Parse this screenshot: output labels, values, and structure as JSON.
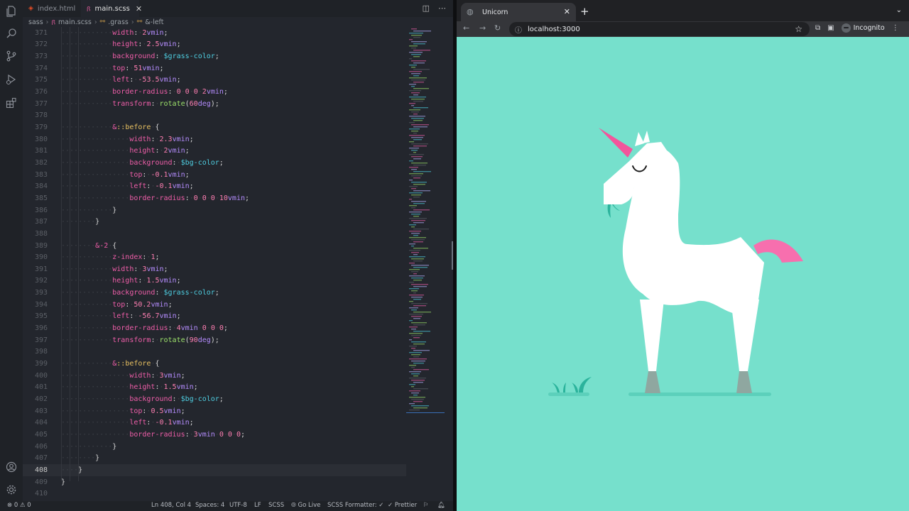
{
  "editor": {
    "tabs": [
      {
        "label": "index.html",
        "active": false,
        "icon": "html5-icon"
      },
      {
        "label": "main.scss",
        "active": true,
        "icon": "sass-icon"
      }
    ],
    "breadcrumb": [
      "sass",
      "main.scss",
      ".grass",
      "&-left"
    ],
    "current_line": 408,
    "lines": [
      {
        "n": "371",
        "indent": 3,
        "prop": "width",
        "value": "2vmin"
      },
      {
        "n": "372",
        "indent": 3,
        "prop": "height",
        "value": "2.5vmin"
      },
      {
        "n": "373",
        "indent": 3,
        "prop": "background",
        "value": "$grass-color"
      },
      {
        "n": "374",
        "indent": 3,
        "prop": "top",
        "value": "51vmin"
      },
      {
        "n": "375",
        "indent": 3,
        "prop": "left",
        "value": "-53.5vmin"
      },
      {
        "n": "376",
        "indent": 3,
        "prop": "border-radius",
        "value": "0 0 0 2vmin"
      },
      {
        "n": "377",
        "indent": 3,
        "prop": "transform",
        "value": "rotate(60deg)"
      },
      {
        "n": "378",
        "indent": 0,
        "raw": ""
      },
      {
        "n": "379",
        "indent": 3,
        "raw": "&::before {"
      },
      {
        "n": "380",
        "indent": 4,
        "prop": "width",
        "value": "2.3vmin"
      },
      {
        "n": "381",
        "indent": 4,
        "prop": "height",
        "value": "2vmin"
      },
      {
        "n": "382",
        "indent": 4,
        "prop": "background",
        "value": "$bg-color"
      },
      {
        "n": "383",
        "indent": 4,
        "prop": "top",
        "value": "-0.1vmin"
      },
      {
        "n": "384",
        "indent": 4,
        "prop": "left",
        "value": "-0.1vmin"
      },
      {
        "n": "385",
        "indent": 4,
        "prop": "border-radius",
        "value": "0 0 0 10vmin"
      },
      {
        "n": "386",
        "indent": 3,
        "raw": "}"
      },
      {
        "n": "387",
        "indent": 2,
        "raw": "}"
      },
      {
        "n": "388",
        "indent": 0,
        "raw": ""
      },
      {
        "n": "389",
        "indent": 2,
        "raw": "&-2 {"
      },
      {
        "n": "390",
        "indent": 3,
        "prop": "z-index",
        "value": "1"
      },
      {
        "n": "391",
        "indent": 3,
        "prop": "width",
        "value": "3vmin"
      },
      {
        "n": "392",
        "indent": 3,
        "prop": "height",
        "value": "1.5vmin"
      },
      {
        "n": "393",
        "indent": 3,
        "prop": "background",
        "value": "$grass-color"
      },
      {
        "n": "394",
        "indent": 3,
        "prop": "top",
        "value": "50.2vmin"
      },
      {
        "n": "395",
        "indent": 3,
        "prop": "left",
        "value": "-56.7vmin"
      },
      {
        "n": "396",
        "indent": 3,
        "prop": "border-radius",
        "value": "4vmin 0 0 0"
      },
      {
        "n": "397",
        "indent": 3,
        "prop": "transform",
        "value": "rotate(90deg)"
      },
      {
        "n": "398",
        "indent": 0,
        "raw": ""
      },
      {
        "n": "399",
        "indent": 3,
        "raw": "&::before {"
      },
      {
        "n": "400",
        "indent": 4,
        "prop": "width",
        "value": "3vmin"
      },
      {
        "n": "401",
        "indent": 4,
        "prop": "height",
        "value": "1.5vmin"
      },
      {
        "n": "402",
        "indent": 4,
        "prop": "background",
        "value": "$bg-color"
      },
      {
        "n": "403",
        "indent": 4,
        "prop": "top",
        "value": "0.5vmin"
      },
      {
        "n": "404",
        "indent": 4,
        "prop": "left",
        "value": "-0.1vmin"
      },
      {
        "n": "405",
        "indent": 4,
        "prop": "border-radius",
        "value": "3vmin 0 0 0"
      },
      {
        "n": "406",
        "indent": 3,
        "raw": "}"
      },
      {
        "n": "407",
        "indent": 2,
        "raw": "}"
      },
      {
        "n": "408",
        "indent": 1,
        "raw": "}"
      },
      {
        "n": "409",
        "indent": 0,
        "raw": "}"
      },
      {
        "n": "410",
        "indent": 0,
        "raw": ""
      }
    ],
    "status": {
      "problems": "0",
      "warnings": "0",
      "position": "Ln 408, Col 4",
      "spaces": "Spaces: 4",
      "encoding": "UTF-8",
      "eol": "LF",
      "language": "SCSS",
      "golive": "Go Live",
      "formatter": "SCSS Formatter: ✓",
      "prettier": "✓ Prettier"
    }
  },
  "browser": {
    "tab_title": "Unicorn",
    "url": "localhost:3000",
    "profile": "Incognito"
  },
  "colors": {
    "bg_color": "#76e0cc",
    "grass_color": "#2bb39c",
    "ground_color": "#5cd0bb",
    "horn_color": "#f2559b",
    "tail_color": "#f76fae",
    "hoof_color": "#8fa7a0",
    "body_color": "#ffffff"
  }
}
